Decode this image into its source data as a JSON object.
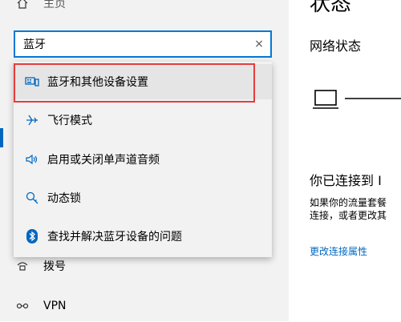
{
  "sidebar": {
    "home_label": "主页",
    "items": [
      {
        "label": "拨号",
        "icon": "dialup-icon"
      },
      {
        "label": "VPN",
        "icon": "vpn-icon"
      }
    ]
  },
  "search": {
    "value": "蓝牙",
    "clear_glyph": "×"
  },
  "suggestions": [
    {
      "label": "蓝牙和其他设备设置",
      "icon": "devices-icon",
      "highlighted": true
    },
    {
      "label": "飞行模式",
      "icon": "airplane-icon"
    },
    {
      "label": "启用或关闭单声道音频",
      "icon": "speaker-icon"
    },
    {
      "label": "动态锁",
      "icon": "key-search-icon"
    },
    {
      "label": "查找并解决蓝牙设备的问题",
      "icon": "bluetooth-icon"
    }
  ],
  "main": {
    "title": "状态",
    "section_title": "网络状态",
    "connected_text": "你已连接到 I",
    "description_line1": "如果你的流量套餐",
    "description_line2": "连接，或者更改其",
    "link_text": "更改连接属性"
  },
  "colors": {
    "accent": "#0067c0",
    "highlight_border": "#e43d3d",
    "search_border": "#0078d7"
  }
}
